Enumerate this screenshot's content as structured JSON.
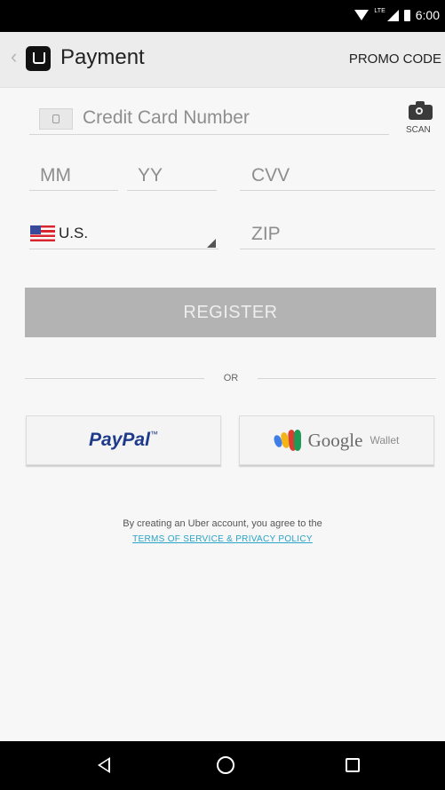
{
  "status_bar": {
    "time": "6:00",
    "network": "LTE",
    "icons": [
      "wifi-icon",
      "signal-icon",
      "battery-icon"
    ]
  },
  "app_bar": {
    "title": "Payment",
    "promo_code": "PROMO CODE",
    "icons": [
      "back-icon",
      "uber-logo"
    ]
  },
  "form": {
    "card_number_placeholder": "Credit Card Number",
    "scan_label": "SCAN",
    "month_placeholder": "MM",
    "year_placeholder": "YY",
    "cvv_placeholder": "CVV",
    "country": "U.S.",
    "zip_placeholder": "ZIP"
  },
  "register_button": "REGISTER",
  "divider_text": "OR",
  "payment_options": {
    "paypal": "PayPal",
    "paypal_tm": "™",
    "google": "Google",
    "wallet": "Wallet"
  },
  "legal": {
    "text": "By creating an Uber account, you agree to the",
    "link": "TERMS OF SERVICE & PRIVACY POLICY"
  },
  "nav_bar": {
    "icons": [
      "nav-back-icon",
      "nav-home-icon",
      "nav-recents-icon"
    ]
  },
  "colors": {
    "register_disabled": "#b3b3b3",
    "link": "#2aa3c8",
    "paypal_blue": "#1e3a8a",
    "background": "#f7f7f7"
  }
}
